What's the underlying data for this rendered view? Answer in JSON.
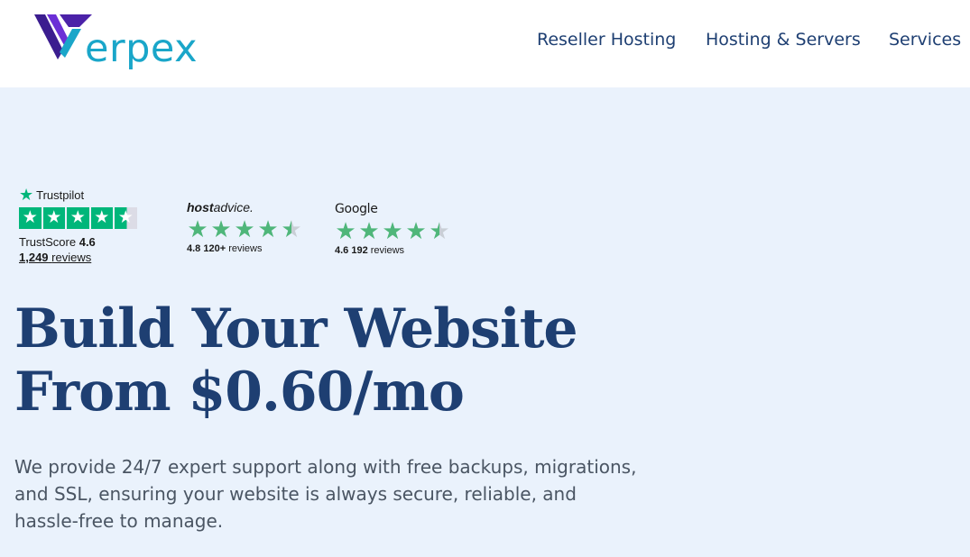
{
  "brand": {
    "name": "Verpex",
    "logo_text": "erpex",
    "colors": {
      "primary": "#1aa6c9",
      "mark_dark": "#3b1d8f",
      "mark_purple": "#6b2fd6",
      "nav": "#1e3f72"
    }
  },
  "nav": {
    "items": [
      {
        "label": "Reseller Hosting"
      },
      {
        "label": "Hosting & Servers"
      },
      {
        "label": "Services"
      }
    ]
  },
  "ratings": {
    "trustpilot": {
      "brand": "Trustpilot",
      "score_label": "TrustScore",
      "score": "4.6",
      "reviews_count": "1,249",
      "reviews_label": "reviews",
      "stars": 4.6,
      "color": "#00b67a"
    },
    "hostadvice": {
      "brand_bold": "host",
      "brand_rest": "advice.",
      "score_text": "4.8 120+",
      "reviews_label": "reviews",
      "stars": 4.8
    },
    "google": {
      "brand": "Google",
      "score_text": "4.6 192",
      "reviews_label": "reviews",
      "stars": 4.6
    }
  },
  "hero": {
    "headline_line1": "Build Your Website",
    "headline_line2": "From $0.60/mo",
    "description": "We provide 24/7 expert support along with free backups, migrations, and SSL, ensuring your website is always secure, reliable, and hassle-free to manage.",
    "background": "#eaf2fc"
  }
}
